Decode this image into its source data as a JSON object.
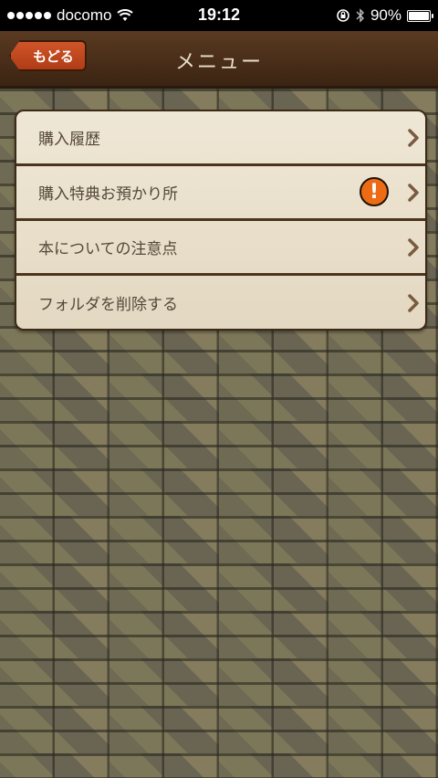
{
  "status_bar": {
    "carrier": "docomo",
    "time": "19:12",
    "battery": "90%",
    "battery_level": 0.9
  },
  "nav": {
    "back_label": "もどる",
    "title": "メニュー"
  },
  "menu": {
    "items": [
      {
        "label": "購入履歴"
      },
      {
        "label": "購入特典お預かり所",
        "alert": "!"
      },
      {
        "label": "本についての注意点"
      },
      {
        "label": "フォルダを削除する"
      }
    ]
  }
}
